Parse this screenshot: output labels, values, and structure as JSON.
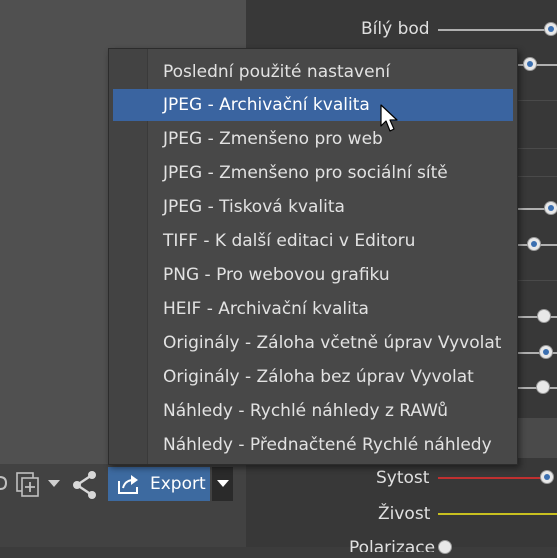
{
  "right_panel": {
    "white_point_label": "Bílý bod",
    "saturation_label": "Sytost",
    "vibrance_label": "Živost",
    "partial_label": "Polarizace"
  },
  "toolbar": {
    "export_label": "Export"
  },
  "export_menu": {
    "items": [
      {
        "label": "Poslední použité nastavení"
      },
      {
        "label": "JPEG - Archivační kvalita"
      },
      {
        "label": "JPEG - Zmenšeno pro web"
      },
      {
        "label": "JPEG - Zmenšeno pro sociální sítě"
      },
      {
        "label": "JPEG - Tisková kvalita"
      },
      {
        "label": "TIFF - K další editaci v Editoru"
      },
      {
        "label": "PNG - Pro webovou grafiku"
      },
      {
        "label": "HEIF - Archivační kvalita"
      },
      {
        "label": "Originály - Záloha včetně úprav Vyvolat"
      },
      {
        "label": "Originály - Záloha bez úprav Vyvolat"
      },
      {
        "label": "Náhledy - Rychlé náhledy z RAWů"
      },
      {
        "label": "Náhledy - Přednačtené Rychlé náhledy"
      }
    ],
    "highlighted_index": 1
  },
  "colors": {
    "accent": "#3d6aa0",
    "highlight": "#3a64a0",
    "saturation_track": "#c03030",
    "vibrance_track": "#c8c020"
  }
}
